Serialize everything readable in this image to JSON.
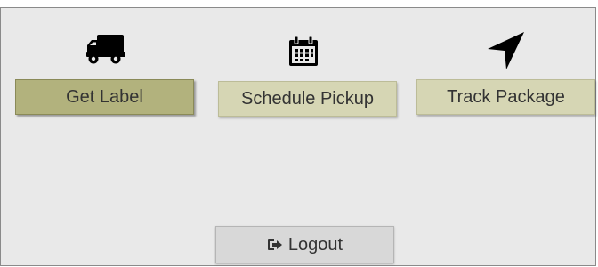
{
  "actions": {
    "get_label": {
      "label": "Get Label",
      "icon": "truck-icon",
      "state": "active"
    },
    "schedule_pickup": {
      "label": "Schedule Pickup",
      "icon": "calendar-icon"
    },
    "track_package": {
      "label": "Track Package",
      "icon": "navigation-arrow-icon"
    }
  },
  "logout": {
    "label": "Logout",
    "icon": "sign-out-icon"
  },
  "colors": {
    "active_button": "#b2b27d",
    "secondary_button": "#d6d6b4",
    "logout_button": "#d8d8d8",
    "panel_background": "#e9e9e9"
  }
}
